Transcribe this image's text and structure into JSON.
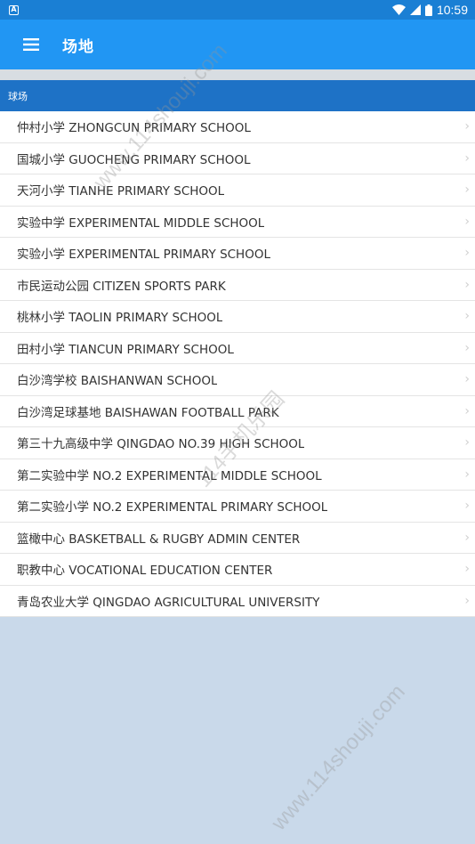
{
  "status_bar": {
    "notification_icon": "A",
    "time": "10:59",
    "icons": [
      "wifi-icon",
      "signal-icon",
      "battery-icon"
    ]
  },
  "app_bar": {
    "title": "场地",
    "menu_icon": "hamburger-menu-icon"
  },
  "section": {
    "header": "球场"
  },
  "venues": [
    "仲村小学 ZHONGCUN PRIMARY SCHOOL",
    "国城小学 GUOCHENG PRIMARY SCHOOL",
    "天河小学 TIANHE PRIMARY SCHOOL",
    "实验中学 EXPERIMENTAL MIDDLE SCHOOL",
    "实验小学 EXPERIMENTAL PRIMARY SCHOOL",
    "市民运动公园 CITIZEN SPORTS PARK",
    "桃林小学 TAOLIN PRIMARY SCHOOL",
    "田村小学 TIANCUN PRIMARY SCHOOL",
    "白沙湾学校 BAISHANWAN SCHOOL",
    "白沙湾足球基地 BAISHAWAN FOOTBALL PARK",
    "第三十九高级中学 QINGDAO NO.39 HIGH SCHOOL",
    "第二实验中学 NO.2 EXPERIMENTAL MIDDLE SCHOOL",
    "第二实验小学 NO.2 EXPERIMENTAL PRIMARY SCHOOL",
    "篮橄中心 BASKETBALL & RUGBY ADMIN CENTER",
    "职教中心 VOCATIONAL EDUCATION CENTER",
    "青岛农业大学 QINGDAO AGRICULTURAL UNIVERSITY"
  ],
  "chevron": "›",
  "watermarks": [
    "www.114shouji.com",
    "114手机乐园",
    "www.114shouji.com"
  ],
  "colors": {
    "status_bar": "#1a7fd4",
    "app_bar": "#2196f3",
    "section_header": "#1e72c6",
    "background": "#c9d9ea"
  }
}
